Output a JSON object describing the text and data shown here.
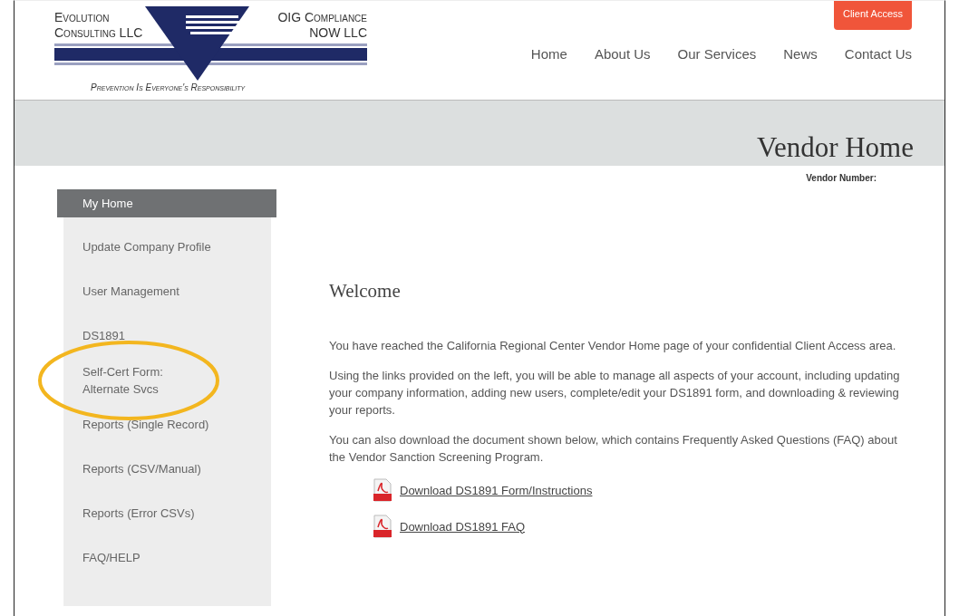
{
  "logo": {
    "left_name": "Evolution Consulting LLC",
    "right_name": "OIG Compliance NOW LLC",
    "tagline": "Prevention Is Everyone's Responsibility"
  },
  "client_access_button": "Client Access",
  "nav": [
    {
      "label": "Home"
    },
    {
      "label": "About Us"
    },
    {
      "label": "Our Services"
    },
    {
      "label": "News"
    },
    {
      "label": "Contact Us"
    }
  ],
  "banner": {
    "title": "Vendor Home",
    "vendor_number_label": "Vendor Number:"
  },
  "sidebar": {
    "items": [
      {
        "label": "My Home",
        "selected": true,
        "highlighted": false
      },
      {
        "label": "Update Company Profile",
        "selected": false,
        "highlighted": false
      },
      {
        "label": "User Management",
        "selected": false,
        "highlighted": false
      },
      {
        "label": "DS1891",
        "selected": false,
        "highlighted": false
      },
      {
        "label": "Self-Cert Form:\nAlternate Svcs",
        "selected": false,
        "highlighted": true
      },
      {
        "label": "Reports (Single Record)",
        "selected": false,
        "highlighted": false
      },
      {
        "label": "Reports (CSV/Manual)",
        "selected": false,
        "highlighted": false
      },
      {
        "label": "Reports (Error CSVs)",
        "selected": false,
        "highlighted": false
      },
      {
        "label": "FAQ/HELP",
        "selected": false,
        "highlighted": false
      }
    ]
  },
  "main": {
    "heading": "Welcome",
    "paragraphs": [
      "You have reached the California Regional Center Vendor Home page of your confidential Client Access area.",
      "Using the links provided on the left, you will be able to manage all aspects of your account, including updating your company information, adding new users, complete/edit your DS1891 form, and downloading & reviewing your reports.",
      "You can also download the document shown below, which contains Frequently Asked Questions (FAQ) about the Vendor Sanction Screening Program."
    ],
    "downloads": [
      {
        "label": "Download DS1891 Form/Instructions"
      },
      {
        "label": "Download DS1891 FAQ"
      }
    ]
  }
}
